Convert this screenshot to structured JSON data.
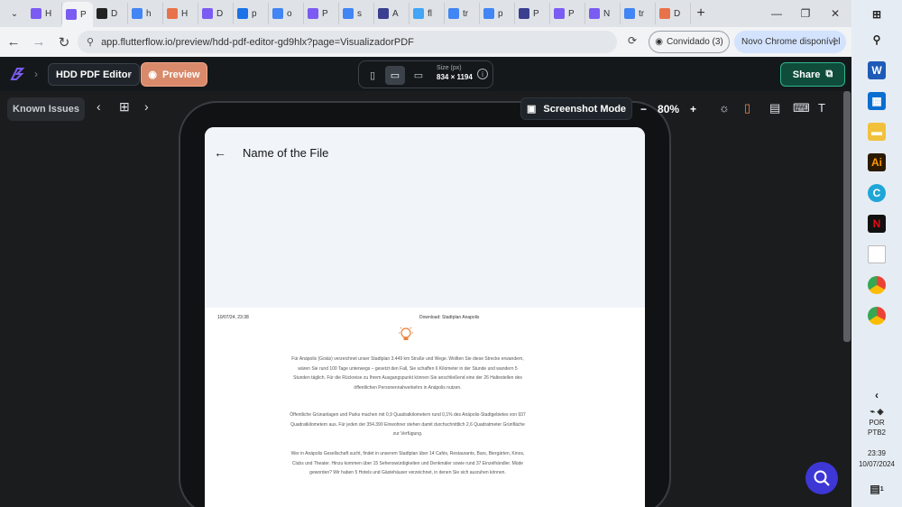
{
  "browser": {
    "tabs": [
      {
        "letter": "H",
        "color": "#7b5cf2"
      },
      {
        "letter": "P",
        "color": "#7b5cf2",
        "active": true
      },
      {
        "letter": "D",
        "color": "#222222"
      },
      {
        "letter": "h",
        "color": "#4285f4"
      },
      {
        "letter": "H",
        "color": "#e8734a"
      },
      {
        "letter": "D",
        "color": "#7b5cf2"
      },
      {
        "letter": "p",
        "color": "#1a73e8"
      },
      {
        "letter": "o",
        "color": "#4285f4"
      },
      {
        "letter": "P",
        "color": "#7b5cf2"
      },
      {
        "letter": "s",
        "color": "#4285f4"
      },
      {
        "letter": "A",
        "color": "#3b3f8f"
      },
      {
        "letter": "fl",
        "color": "#42a5f5"
      },
      {
        "letter": "tr",
        "color": "#4285f4"
      },
      {
        "letter": "p",
        "color": "#4285f4"
      },
      {
        "letter": "P",
        "color": "#3b3f8f"
      },
      {
        "letter": "P",
        "color": "#7b5cf2"
      },
      {
        "letter": "N",
        "color": "#7b5cf2"
      },
      {
        "letter": "tr",
        "color": "#4285f4"
      },
      {
        "letter": "D",
        "color": "#e8734a"
      }
    ],
    "url": "app.flutterflow.io/preview/hdd-pdf-editor-gd9hlx?page=VisualizadorPDF",
    "profile_label": "Convidado (3)",
    "update_label": "Novo Chrome disponível"
  },
  "flutterflow": {
    "project_name": "HDD PDF Editor",
    "preview_label": "Preview",
    "size_label": "Size (px)",
    "size_value": "834 × 1194",
    "share_label": "Share",
    "known_issues_label": "Known Issues",
    "screenshot_mode_label": "Screenshot Mode",
    "zoom_value": "80%"
  },
  "app": {
    "title": "Name of the File",
    "pdf": {
      "date": "10/07/24, 23:38",
      "header": "Download: Stadtplan Anapolis",
      "paragraphs": [
        "Für Anápolis (Goiás) verzeichnet unser Stadtplan 3.449 km Straße und Wege. Wollten Sie diese Strecke erwandern, wären Sie rund 100 Tage unterwegs – gesetzt den Fall, Sie schaffen 6 Kilometer in der Stunde und wandern 5 Stunden täglich. Für die Rückreise zu Ihrem Ausgangspunkt können Sie anschließend eine der 26 Haltestellen des öffentlichen Personennahverkehrs in Anápolis nutzen.",
        "Öffentliche Grünanlagen und Parks machen mit 0,9 Quadratkilometern rund 0,1% des Anápolis-Stadtgebietes von 937 Quadratkilometern aus. Für jeden der 354.390 Einwohner stehen damit durchschnittlich 2,6 Quadratmeter Grünfläche zur Verfügung.",
        "Wer in Anápolis Gesellschaft sucht, findet in unserem Stadtplan über 14 Cafés, Restaurants, Bars, Biergärten, Kinos, Clubs und Theater. Hinzu kommen über 15 Sehenswürdigkeiten und Denkmäler sowie rund 37 Einzelhändler. Müde geworden? Wir haben 5 Hotels und Gästehäuser verzeichnet, in denen Sie sich ausruhen können."
      ]
    }
  },
  "taskbar": {
    "lang": "POR",
    "layout": "PTB2",
    "time": "23:39",
    "date": "10/07/2024",
    "notifications": "1"
  }
}
